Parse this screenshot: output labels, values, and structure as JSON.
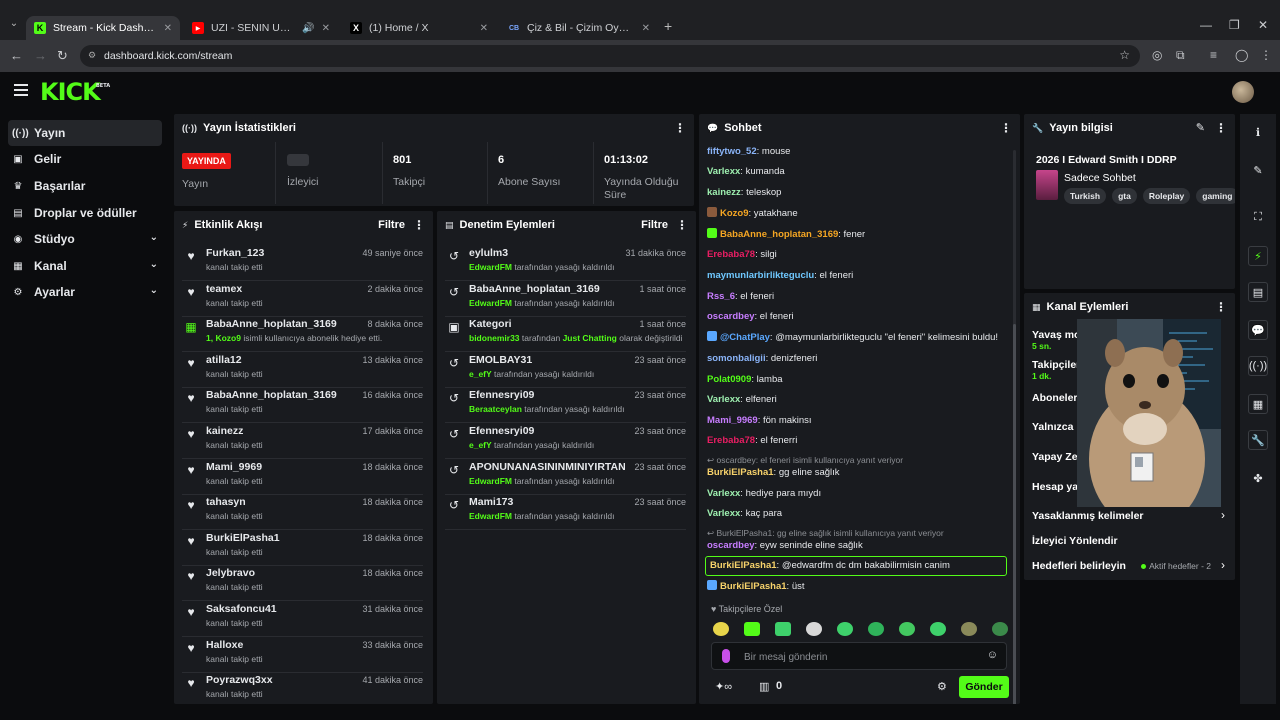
{
  "browser": {
    "tabs": [
      {
        "title": "Stream - Kick Dashboard",
        "active": true,
        "favicon": "kick-icon"
      },
      {
        "title": "UZI - SENIN UGRUNA FT M",
        "active": false,
        "favicon": "youtube-icon"
      },
      {
        "title": "(1) Home / X",
        "active": false,
        "favicon": "x-icon"
      },
      {
        "title": "Çiz & Bil - Çizim Oyunu",
        "active": false,
        "favicon": "cb-icon"
      }
    ],
    "url": "dashboard.kick.com/stream"
  },
  "header": {
    "logo": "KICK",
    "beta": "BETA"
  },
  "sidebar": {
    "items": [
      {
        "label": "Yayın",
        "icon": "broadcast-icon",
        "active": true
      },
      {
        "label": "Gelir",
        "icon": "money-icon"
      },
      {
        "label": "Başarılar",
        "icon": "trophy-icon"
      },
      {
        "label": "Droplar ve ödüller",
        "icon": "gift-icon"
      },
      {
        "label": "Stüdyo",
        "icon": "studio-icon",
        "expandable": true
      },
      {
        "label": "Kanal",
        "icon": "channel-icon",
        "expandable": true
      },
      {
        "label": "Ayarlar",
        "icon": "settings-icon",
        "expandable": true
      }
    ]
  },
  "stats": {
    "title": "Yayın İstatistikleri",
    "live_badge": "YAYINDA",
    "items": [
      {
        "value": "",
        "label": "Yayın"
      },
      {
        "value": "",
        "label": "İzleyici"
      },
      {
        "value": "801",
        "label": "Takipçi"
      },
      {
        "value": "6",
        "label": "Abone Sayısı"
      },
      {
        "value": "01:13:02",
        "label": "Yayında Olduğu Süre"
      }
    ]
  },
  "activity": {
    "title": "Etkinlik Akışı",
    "filter": "Filtre",
    "rows": [
      {
        "name": "Furkan_123",
        "time": "49 saniye önce",
        "sub": "kanalı takip etti",
        "icon": "heart-icon"
      },
      {
        "name": "teamex",
        "time": "2 dakika önce",
        "sub": "kanalı takip etti",
        "icon": "heart-icon"
      },
      {
        "name": "BabaAnne_hoplatan_3169",
        "time": "8 dakika önce",
        "sub_user": "1, Kozo9",
        "sub": " isimli kullanıcıya abonelik hediye etti.",
        "icon": "gift-sub-icon"
      },
      {
        "name": "atilla12",
        "time": "13 dakika önce",
        "sub": "kanalı takip etti",
        "icon": "heart-icon"
      },
      {
        "name": "BabaAnne_hoplatan_3169",
        "time": "16 dakika önce",
        "sub": "kanalı takip etti",
        "icon": "heart-icon"
      },
      {
        "name": "kainezz",
        "time": "17 dakika önce",
        "sub": "kanalı takip etti",
        "icon": "heart-icon"
      },
      {
        "name": "Mami_9969",
        "time": "18 dakika önce",
        "sub": "kanalı takip etti",
        "icon": "heart-icon"
      },
      {
        "name": "tahasyn",
        "time": "18 dakika önce",
        "sub": "kanalı takip etti",
        "icon": "heart-icon"
      },
      {
        "name": "BurkiElPasha1",
        "time": "18 dakika önce",
        "sub": "kanalı takip etti",
        "icon": "heart-icon"
      },
      {
        "name": "Jelybravo",
        "time": "18 dakika önce",
        "sub": "kanalı takip etti",
        "icon": "heart-icon"
      },
      {
        "name": "Saksafoncu41",
        "time": "31 dakika önce",
        "sub": "kanalı takip etti",
        "icon": "heart-icon"
      },
      {
        "name": "Halloxe",
        "time": "33 dakika önce",
        "sub": "kanalı takip etti",
        "icon": "heart-icon"
      },
      {
        "name": "Poyrazwq3xx",
        "time": "41 dakika önce",
        "sub": "kanalı takip etti",
        "icon": "heart-icon"
      }
    ]
  },
  "moderation": {
    "title": "Denetim Eylemleri",
    "filter": "Filtre",
    "rows": [
      {
        "name": "eylulm3",
        "time": "31 dakika önce",
        "sub_user": "EdwardFM",
        "sub": " tarafından yasağı kaldırıldı",
        "icon": "unban-icon"
      },
      {
        "name": "BabaAnne_hoplatan_3169",
        "time": "1 saat önce",
        "sub_user": "EdwardFM",
        "sub": " tarafından yasağı kaldırıldı",
        "icon": "unban-icon"
      },
      {
        "name": "Kategori",
        "time": "1 saat önce",
        "sub_user": "bidonemir33",
        "sub": " tarafından ",
        "sub_cat": "Just Chatting",
        "sub_end": " olarak değiştirildi",
        "icon": "category-icon"
      },
      {
        "name": "EMOLBAY31",
        "time": "23 saat önce",
        "sub_user": "e_efY",
        "sub": " tarafından yasağı kaldırıldı",
        "icon": "unban-icon"
      },
      {
        "name": "Efennesryi09",
        "time": "23 saat önce",
        "sub_user": "Beraatceylan",
        "sub": " tarafından yasağı kaldırıldı",
        "icon": "unban-icon"
      },
      {
        "name": "Efennesryi09",
        "time": "23 saat önce",
        "sub_user": "e_efY",
        "sub": " tarafından yasağı kaldırıldı",
        "icon": "unban-icon"
      },
      {
        "name": "APONUNANASININMINIYIRTAN",
        "time": "23 saat önce",
        "sub_user": "EdwardFM",
        "sub": " tarafından yasağı kaldırıldı",
        "icon": "unban-icon"
      },
      {
        "name": "Mami173",
        "time": "23 saat önce",
        "sub_user": "EdwardFM",
        "sub": " tarafından yasağı kaldırıldı",
        "icon": "unban-icon"
      }
    ]
  },
  "chat": {
    "title": "Sohbet",
    "messages": [
      {
        "user": "fiftytwo_52",
        "color": "#8ab4f8",
        "text": ": mouse"
      },
      {
        "user": "Varlexx",
        "color": "#9ef0b0",
        "text": ": kumanda"
      },
      {
        "user": "kainezz",
        "color": "#9ef0b0",
        "text": ": teleskop"
      },
      {
        "user": "Kozo9",
        "color": "#f5a623",
        "text": ": yatakhane",
        "badge": "#8a5a3c"
      },
      {
        "user": "BabaAnne_hoplatan_3169",
        "color": "#f5a623",
        "text": ": fener",
        "badge": "#53fc18"
      },
      {
        "user": "Erebaba78",
        "color": "#e91e63",
        "text": ": silgi"
      },
      {
        "user": "maymunlarbirlikteguclu",
        "color": "#6fc8ff",
        "text": ": el feneri"
      },
      {
        "user": "Rss_6",
        "color": "#c77dff",
        "text": ": el feneri"
      },
      {
        "user": "oscardbey",
        "color": "#c77dff",
        "text": ": el feneri"
      },
      {
        "user": "@ChatPlay",
        "color": "#5aa8ff",
        "text": ": @maymunlarbirlikteguclu \"el feneri\" kelimesini buldu!",
        "badge": "#5aa8ff"
      },
      {
        "user": "somonbaligii",
        "color": "#8ab4f8",
        "text": ": denizfeneri"
      },
      {
        "user": "Polat0909",
        "color": "#53fc18",
        "text": ": lamba"
      },
      {
        "user": "Varlexx",
        "color": "#9ef0b0",
        "text": ": elfeneri"
      },
      {
        "user": "Mami_9969",
        "color": "#c77dff",
        "text": ": fön makinsı"
      },
      {
        "user": "Erebaba78",
        "color": "#e91e63",
        "text": ": el fenerri"
      },
      {
        "reply": "↩ oscardbey: el feneri isimli kullanıcıya yanıt veriyor"
      },
      {
        "user": "BurkiElPasha1",
        "color": "#f7d26b",
        "text": ": gg eline sağlık"
      },
      {
        "user": "Varlexx",
        "color": "#9ef0b0",
        "text": ": hediye para mıydı"
      },
      {
        "user": "Varlexx",
        "color": "#9ef0b0",
        "text": ": kaç para"
      },
      {
        "reply": "↩ BurkiElPasha1: gg eline sağlık isimli kullanıcıya yanıt veriyor"
      },
      {
        "user": "oscardbey",
        "color": "#c77dff",
        "text": ": eyw seninde eline sağlık"
      },
      {
        "user": "BurkiElPasha1",
        "color": "#f7d26b",
        "text": ": @edwardfm dc dm bakabilirmisin canim",
        "highlight": true
      },
      {
        "user": "BurkiElPasha1",
        "color": "#f7d26b",
        "text": ": üst",
        "badge": "#5aa8ff"
      }
    ],
    "follow_only": "♥ Takipçilere Özel",
    "input_placeholder": "Bir mesaj gönderin",
    "points": "0",
    "send_label": "Gönder"
  },
  "stream_info": {
    "title": "Yayın bilgisi",
    "stream_title": "2026 I Edward Smith I DDRP",
    "category": "Sadece Sohbet",
    "tags": [
      "Turkish",
      "gta",
      "Roleplay",
      "gaming"
    ]
  },
  "channel_actions": {
    "title": "Kanal Eylemleri",
    "rows": [
      {
        "label": "Yavaş mod",
        "sub": "5 sn."
      },
      {
        "label": "Takipçiler",
        "sub": "1 dk."
      },
      {
        "label": "Aboneler"
      },
      {
        "label": "Yalnızca i"
      },
      {
        "label": "Yapay Zek"
      },
      {
        "label": "Hesap yaş"
      },
      {
        "label": "Yasaklanmış kelimeler"
      },
      {
        "label": "İzleyici Yönlendir"
      },
      {
        "label": "Hedefleri belirleyin",
        "goals": "Aktif hedefler - 2"
      }
    ]
  },
  "colors": {
    "accent": "#53fc18",
    "live": "#e91916",
    "panel": "#191b1f",
    "bg": "#0b0c0e"
  }
}
